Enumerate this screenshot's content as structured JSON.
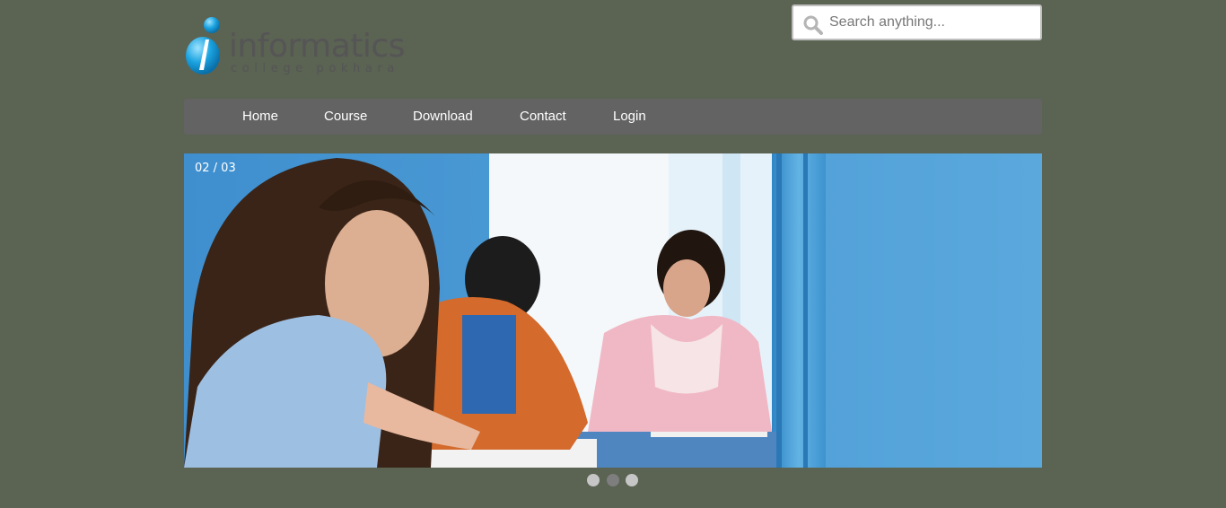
{
  "logo": {
    "word": "informatics",
    "subline": "college pokhara"
  },
  "search": {
    "placeholder": "Search anything..."
  },
  "nav": {
    "items": [
      {
        "label": "Home"
      },
      {
        "label": "Course"
      },
      {
        "label": "Download"
      },
      {
        "label": "Contact"
      },
      {
        "label": "Login"
      }
    ]
  },
  "slider": {
    "counter": "02 / 03",
    "current_slide": 2,
    "total_slides": 3
  },
  "colors": {
    "background": "#5b6353",
    "nav_bar": "#636363",
    "logo_accent": "#1aa3e0"
  }
}
